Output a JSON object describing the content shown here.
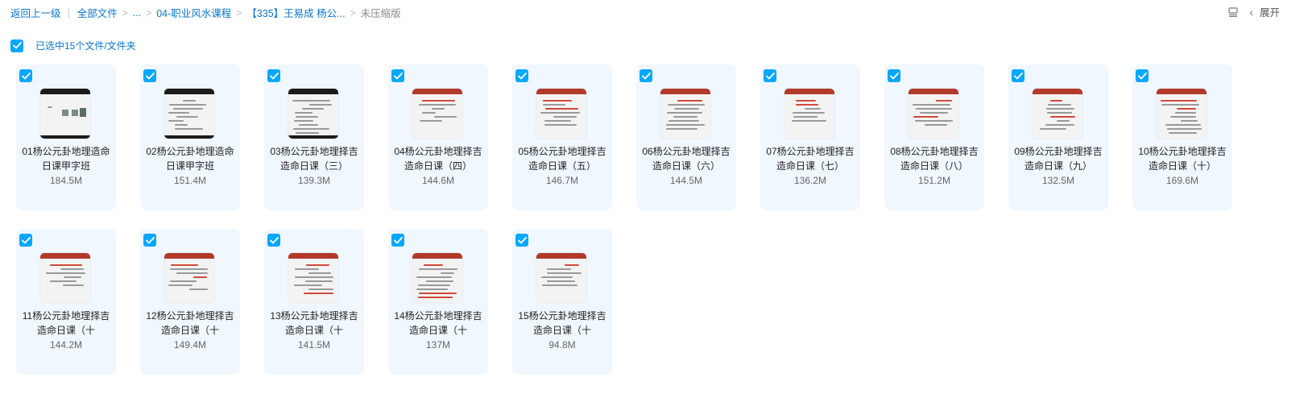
{
  "breadcrumb": {
    "back": "返回上一级",
    "all_files": "全部文件",
    "ellipsis": "...",
    "level1": "04-职业风水课程",
    "level2": "【335】王易成 杨公...",
    "current": "未压缩版"
  },
  "toolbar": {
    "expand_label": "展开",
    "list_icon": "list-view-icon",
    "chevron_icon": "chevron-left-icon"
  },
  "selection": {
    "label": "已选中15个文件/文件夹",
    "checked": true
  },
  "colors": {
    "accent": "#06a7ff",
    "link": "#0a75ce",
    "card_bg": "#f0f7fe"
  },
  "files": [
    {
      "name": "01杨公元卦地理造命日课甲字班",
      "size": "184.5M",
      "thumb": "dark",
      "checked": true
    },
    {
      "name": "02杨公元卦地理造命日课甲字班",
      "size": "151.4M",
      "thumb": "dark",
      "checked": true
    },
    {
      "name": "03杨公元卦地理择吉造命日课（三）",
      "size": "139.3M",
      "thumb": "dark",
      "checked": true
    },
    {
      "name": "04杨公元卦地理择吉造命日课（四）",
      "size": "144.6M",
      "thumb": "red",
      "checked": true
    },
    {
      "name": "05杨公元卦地理择吉造命日课（五）",
      "size": "146.7M",
      "thumb": "red",
      "checked": true
    },
    {
      "name": "06杨公元卦地理择吉造命日课（六）",
      "size": "144.5M",
      "thumb": "red",
      "checked": true
    },
    {
      "name": "07杨公元卦地理择吉造命日课（七）",
      "size": "136.2M",
      "thumb": "red",
      "checked": true
    },
    {
      "name": "08杨公元卦地理择吉造命日课（八）",
      "size": "151.2M",
      "thumb": "red",
      "checked": true
    },
    {
      "name": "09杨公元卦地理择吉造命日课（九）",
      "size": "132.5M",
      "thumb": "red",
      "checked": true
    },
    {
      "name": "10杨公元卦地理择吉造命日课（十）",
      "size": "169.6M",
      "thumb": "red",
      "checked": true
    },
    {
      "name": "11杨公元卦地理择吉造命日课（十",
      "size": "144.2M",
      "thumb": "red",
      "checked": true
    },
    {
      "name": "12杨公元卦地理择吉造命日课（十",
      "size": "149.4M",
      "thumb": "red",
      "checked": true
    },
    {
      "name": "13杨公元卦地理择吉造命日课（十",
      "size": "141.5M",
      "thumb": "red",
      "checked": true
    },
    {
      "name": "14杨公元卦地理择吉造命日课（十",
      "size": "137M",
      "thumb": "red",
      "checked": true
    },
    {
      "name": "15杨公元卦地理择吉造命日课（十",
      "size": "94.8M",
      "thumb": "red",
      "checked": true
    }
  ]
}
